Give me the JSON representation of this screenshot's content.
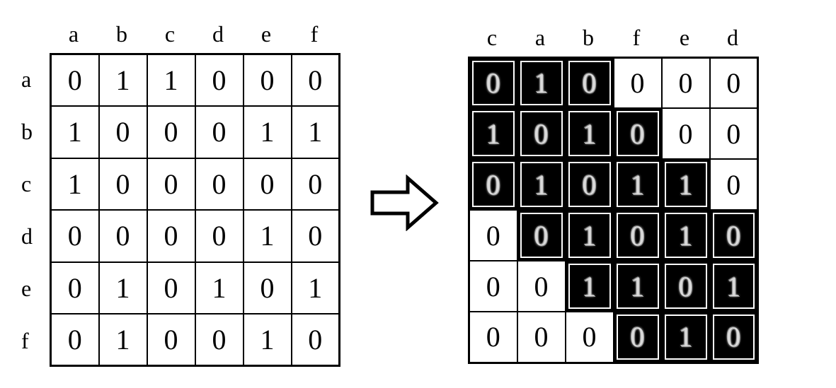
{
  "matrix_left": {
    "col_labels": [
      "a",
      "b",
      "c",
      "d",
      "e",
      "f"
    ],
    "row_labels": [
      "a",
      "b",
      "c",
      "d",
      "e",
      "f"
    ],
    "cells": [
      [
        {
          "v": "0",
          "s": 0
        },
        {
          "v": "1",
          "s": 0
        },
        {
          "v": "1",
          "s": 0
        },
        {
          "v": "0",
          "s": 0
        },
        {
          "v": "0",
          "s": 0
        },
        {
          "v": "0",
          "s": 0
        }
      ],
      [
        {
          "v": "1",
          "s": 0
        },
        {
          "v": "0",
          "s": 0
        },
        {
          "v": "0",
          "s": 0
        },
        {
          "v": "0",
          "s": 0
        },
        {
          "v": "1",
          "s": 0
        },
        {
          "v": "1",
          "s": 0
        }
      ],
      [
        {
          "v": "1",
          "s": 0
        },
        {
          "v": "0",
          "s": 0
        },
        {
          "v": "0",
          "s": 0
        },
        {
          "v": "0",
          "s": 0
        },
        {
          "v": "0",
          "s": 0
        },
        {
          "v": "0",
          "s": 0
        }
      ],
      [
        {
          "v": "0",
          "s": 0
        },
        {
          "v": "0",
          "s": 0
        },
        {
          "v": "0",
          "s": 0
        },
        {
          "v": "0",
          "s": 0
        },
        {
          "v": "1",
          "s": 0
        },
        {
          "v": "0",
          "s": 0
        }
      ],
      [
        {
          "v": "0",
          "s": 0
        },
        {
          "v": "1",
          "s": 0
        },
        {
          "v": "0",
          "s": 0
        },
        {
          "v": "1",
          "s": 0
        },
        {
          "v": "0",
          "s": 0
        },
        {
          "v": "1",
          "s": 0
        }
      ],
      [
        {
          "v": "0",
          "s": 0
        },
        {
          "v": "1",
          "s": 0
        },
        {
          "v": "0",
          "s": 0
        },
        {
          "v": "0",
          "s": 0
        },
        {
          "v": "1",
          "s": 0
        },
        {
          "v": "0",
          "s": 0
        }
      ]
    ]
  },
  "matrix_right": {
    "col_labels": [
      "c",
      "a",
      "b",
      "f",
      "e",
      "d"
    ],
    "row_labels": [
      "",
      "",
      "",
      "",
      "",
      ""
    ],
    "cells": [
      [
        {
          "v": "0",
          "s": 1
        },
        {
          "v": "1",
          "s": 1
        },
        {
          "v": "0",
          "s": 1
        },
        {
          "v": "0",
          "s": 0
        },
        {
          "v": "0",
          "s": 0
        },
        {
          "v": "0",
          "s": 0
        }
      ],
      [
        {
          "v": "1",
          "s": 1
        },
        {
          "v": "0",
          "s": 1
        },
        {
          "v": "1",
          "s": 1
        },
        {
          "v": "0",
          "s": 1
        },
        {
          "v": "0",
          "s": 0
        },
        {
          "v": "0",
          "s": 0
        }
      ],
      [
        {
          "v": "0",
          "s": 1
        },
        {
          "v": "1",
          "s": 1
        },
        {
          "v": "0",
          "s": 1
        },
        {
          "v": "1",
          "s": 1
        },
        {
          "v": "1",
          "s": 1
        },
        {
          "v": "0",
          "s": 0
        }
      ],
      [
        {
          "v": "0",
          "s": 0
        },
        {
          "v": "0",
          "s": 1
        },
        {
          "v": "1",
          "s": 1
        },
        {
          "v": "0",
          "s": 1
        },
        {
          "v": "1",
          "s": 1
        },
        {
          "v": "0",
          "s": 1
        }
      ],
      [
        {
          "v": "0",
          "s": 0
        },
        {
          "v": "0",
          "s": 0
        },
        {
          "v": "1",
          "s": 1
        },
        {
          "v": "1",
          "s": 1
        },
        {
          "v": "0",
          "s": 1
        },
        {
          "v": "1",
          "s": 1
        }
      ],
      [
        {
          "v": "0",
          "s": 0
        },
        {
          "v": "0",
          "s": 0
        },
        {
          "v": "0",
          "s": 0
        },
        {
          "v": "0",
          "s": 1
        },
        {
          "v": "1",
          "s": 1
        },
        {
          "v": "0",
          "s": 1
        }
      ]
    ]
  },
  "chart_data": {
    "type": "table",
    "description": "Adjacency matrix reordering (bandwidth reduction). Left: original 6x6 symmetric 0/1 matrix ordered a,b,c,d,e,f. Right: same matrix permuted to order c,a,b,f,e,d with band (near-diagonal) entries highlighted.",
    "left": {
      "order": [
        "a",
        "b",
        "c",
        "d",
        "e",
        "f"
      ],
      "data": [
        [
          0,
          1,
          1,
          0,
          0,
          0
        ],
        [
          1,
          0,
          0,
          0,
          1,
          1
        ],
        [
          1,
          0,
          0,
          0,
          0,
          0
        ],
        [
          0,
          0,
          0,
          0,
          1,
          0
        ],
        [
          0,
          1,
          0,
          1,
          0,
          1
        ],
        [
          0,
          1,
          0,
          0,
          1,
          0
        ]
      ]
    },
    "right": {
      "order": [
        "c",
        "a",
        "b",
        "f",
        "e",
        "d"
      ],
      "data": [
        [
          0,
          1,
          0,
          0,
          0,
          0
        ],
        [
          1,
          0,
          1,
          0,
          0,
          0
        ],
        [
          0,
          1,
          0,
          1,
          1,
          0
        ],
        [
          0,
          0,
          1,
          0,
          1,
          0
        ],
        [
          0,
          0,
          1,
          1,
          0,
          1
        ],
        [
          0,
          0,
          0,
          0,
          1,
          0
        ]
      ],
      "highlighted_band": [
        [
          1,
          1,
          1,
          0,
          0,
          0
        ],
        [
          1,
          1,
          1,
          1,
          0,
          0
        ],
        [
          1,
          1,
          1,
          1,
          1,
          0
        ],
        [
          0,
          1,
          1,
          1,
          1,
          1
        ],
        [
          0,
          0,
          1,
          1,
          1,
          1
        ],
        [
          0,
          0,
          0,
          1,
          1,
          1
        ]
      ]
    }
  }
}
